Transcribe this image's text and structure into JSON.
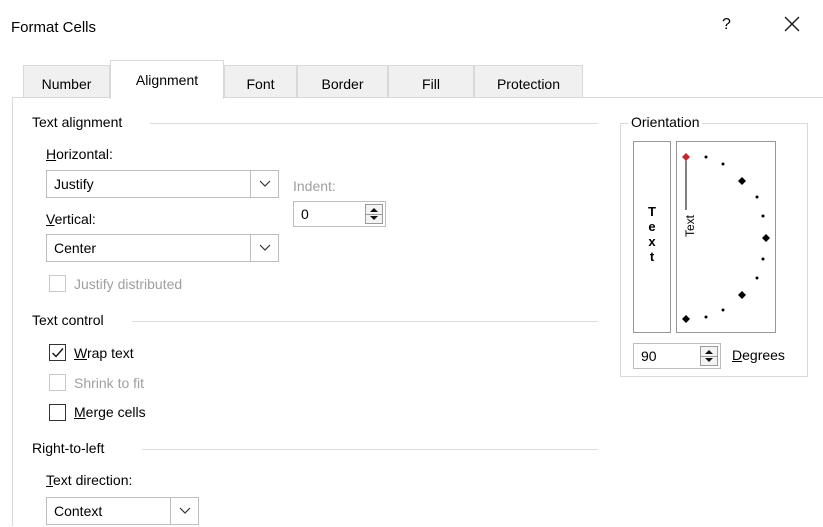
{
  "window": {
    "title": "Format Cells",
    "help": "?"
  },
  "tabs": [
    {
      "label": "Number"
    },
    {
      "label": "Alignment",
      "active": true
    },
    {
      "label": "Font"
    },
    {
      "label": "Border"
    },
    {
      "label": "Fill"
    },
    {
      "label": "Protection"
    }
  ],
  "text_alignment": {
    "section": "Text alignment",
    "horizontal_label": "Horizontal:",
    "horizontal_value": "Justify",
    "indent_label": "Indent:",
    "indent_value": "0",
    "vertical_label": "Vertical:",
    "vertical_value": "Center",
    "justify_distributed": {
      "label": "Justify distributed",
      "checked": false,
      "enabled": false
    }
  },
  "text_control": {
    "section": "Text control",
    "wrap": {
      "label": "Wrap text",
      "checked": true
    },
    "shrink": {
      "label": "Shrink to fit",
      "checked": false,
      "enabled": false
    },
    "merge": {
      "label": "Merge cells",
      "checked": false
    }
  },
  "rtl": {
    "section": "Right-to-left",
    "direction_label": "Text direction:",
    "direction_value": "Context"
  },
  "orientation": {
    "section": "Orientation",
    "vertical_letters": [
      "T",
      "e",
      "x",
      "t"
    ],
    "dial_text": "Text",
    "degrees_value": "90",
    "degrees_label": "Degrees"
  },
  "colors": {
    "accent_marker": "#c0282d",
    "border": "#d9d9d9"
  }
}
